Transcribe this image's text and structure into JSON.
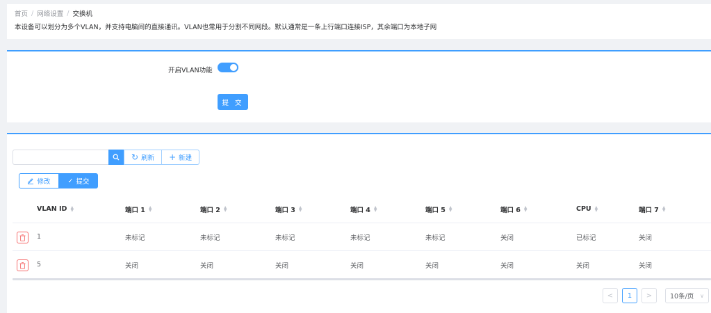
{
  "breadcrumb": [
    "首页",
    "网络设置",
    "交换机"
  ],
  "description": "本设备可以划分为多个VLAN，并支持电脑间的直接通讯。VLAN也常用于分割不同网段。默认通常是一条上行端口连接ISP，其余端口为本地子网",
  "vlan_form": {
    "switch_label": "开启VLAN功能",
    "switch_on": true,
    "submit_label": "提 交"
  },
  "toolbar": {
    "search_placeholder": "",
    "refresh_label": "刷新",
    "new_label": "新建",
    "edit_label": "修改",
    "submit_label": "提交"
  },
  "table": {
    "columns": [
      "VLAN ID",
      "端口 1",
      "端口 2",
      "端口 3",
      "端口 4",
      "端口 5",
      "端口 6",
      "CPU",
      "端口 7"
    ],
    "rows": [
      [
        "1",
        "未标记",
        "未标记",
        "未标记",
        "未标记",
        "未标记",
        "关闭",
        "已标记",
        "关闭"
      ],
      [
        "5",
        "关闭",
        "关闭",
        "关闭",
        "关闭",
        "关闭",
        "关闭",
        "关闭",
        "关闭"
      ]
    ]
  },
  "pagination": {
    "prev": "<",
    "current_page": "1",
    "next": ">",
    "page_size": "10条/页"
  },
  "colors": {
    "primary": "#409eff",
    "danger": "#f56c6c"
  }
}
